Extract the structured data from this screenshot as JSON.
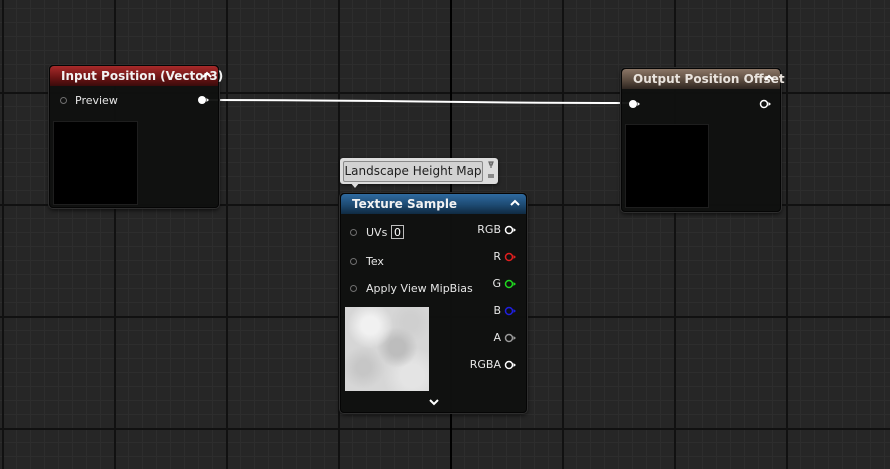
{
  "graph": {
    "nodes": {
      "input_position": {
        "title": "Input Position (Vector3)",
        "output_pin": "Preview"
      },
      "output_offset": {
        "title": "Output Position Offset"
      },
      "texture_sample": {
        "title": "Texture Sample",
        "comment": "Landscape Height Map",
        "inputs": {
          "uvs": "UVs",
          "uvs_value": "0",
          "tex": "Tex",
          "mip": "Apply View MipBias"
        },
        "outputs": {
          "rgb": "RGB",
          "r": "R",
          "g": "G",
          "b": "B",
          "a": "A",
          "rgba": "RGBA"
        }
      }
    }
  },
  "colors": {
    "header_input": "#8f1f1f",
    "header_output": "#6e5c4f",
    "header_texture": "#245784",
    "pin_r": "#e21f1f",
    "pin_g": "#1fd81f",
    "pin_b": "#1f1fe2",
    "wire": "#ffffff"
  },
  "icons": {
    "collapse": "chevron-up-icon",
    "expand": "chevron-down-icon",
    "pin": "exec-pin-icon"
  }
}
